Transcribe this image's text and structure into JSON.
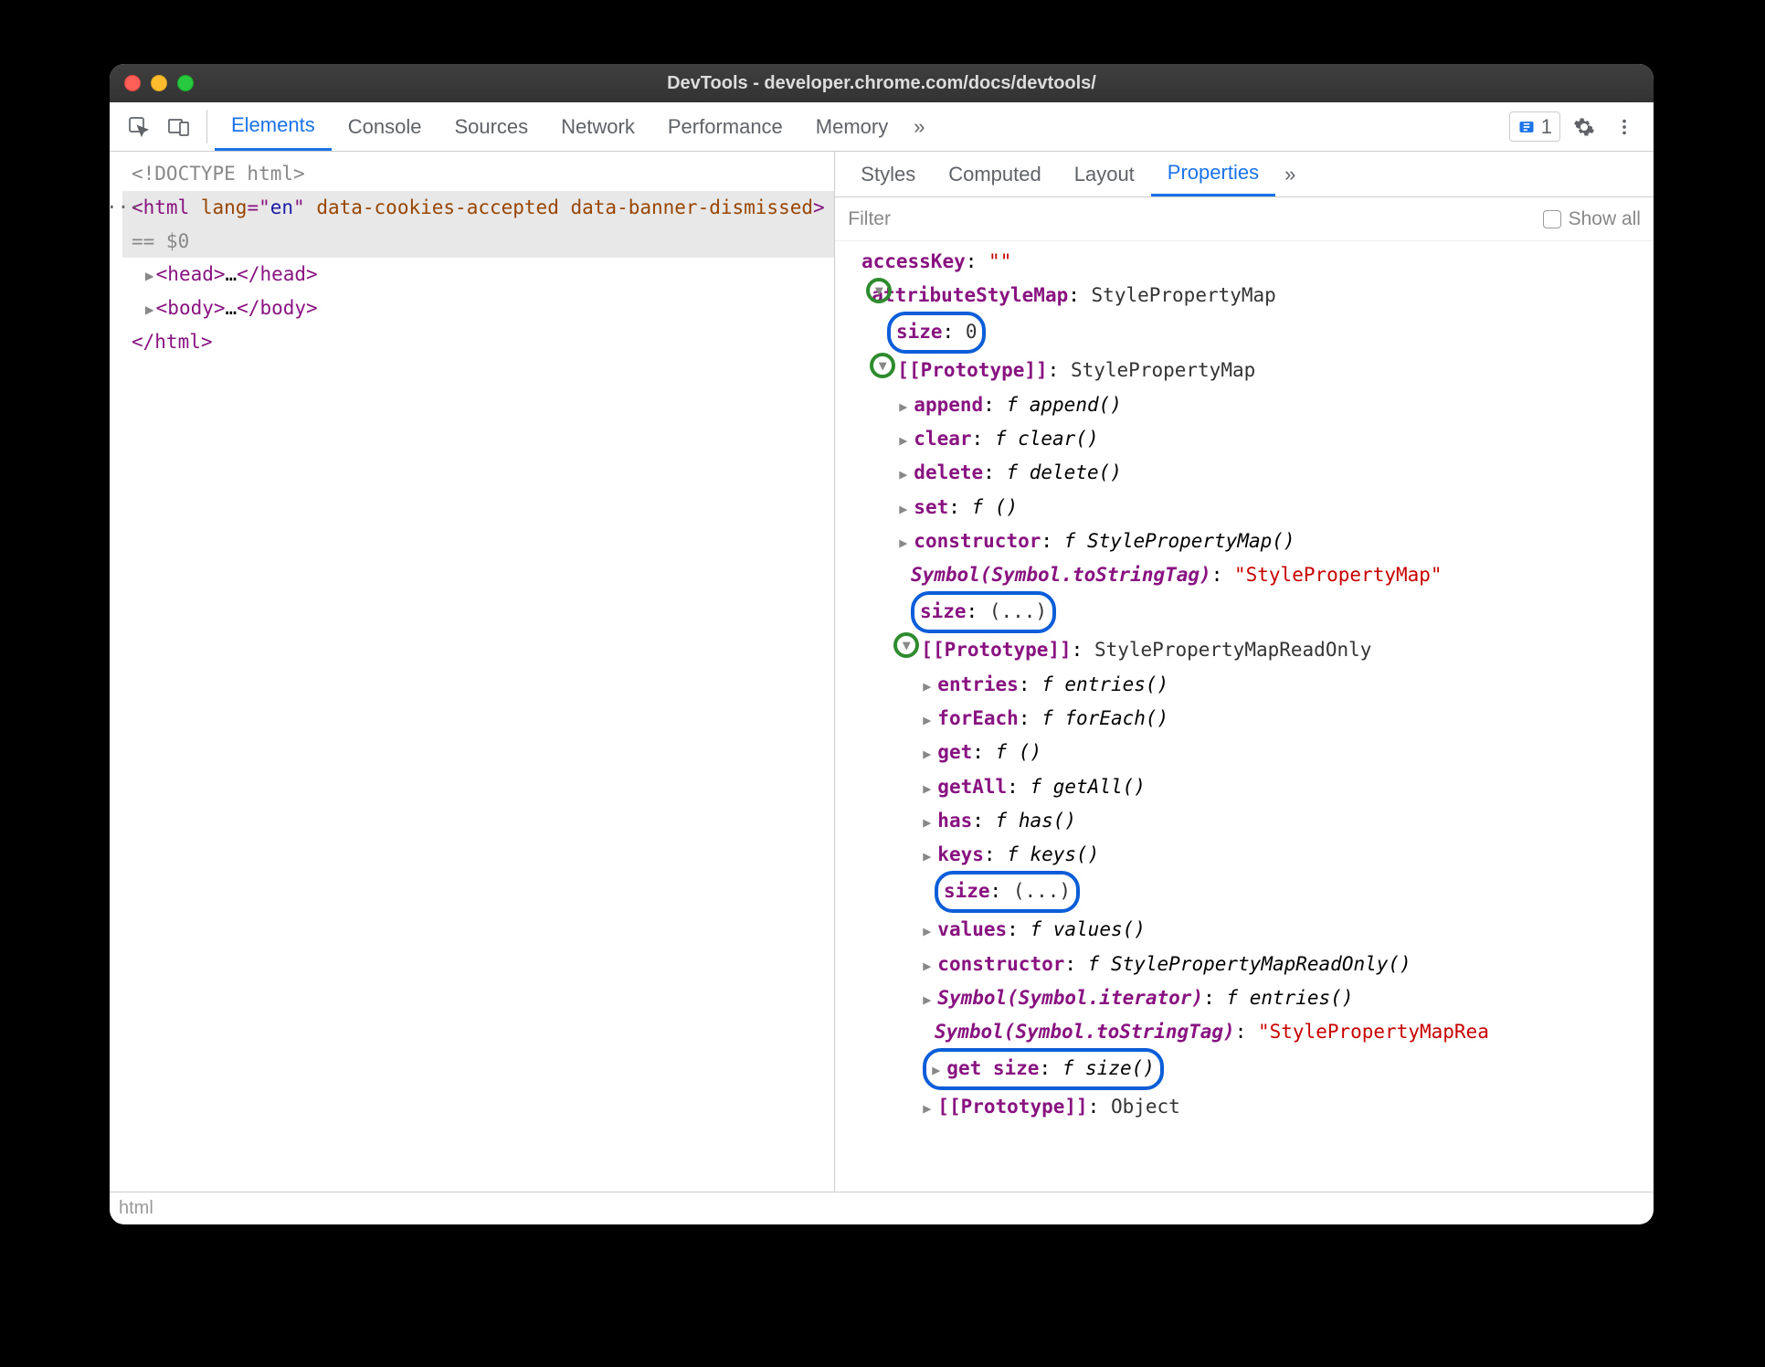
{
  "titlebar": {
    "title": "DevTools - developer.chrome.com/docs/devtools/"
  },
  "toolbar": {
    "tabs": [
      "Elements",
      "Console",
      "Sources",
      "Network",
      "Performance",
      "Memory"
    ],
    "active": "Elements",
    "moreGlyph": "»",
    "issuesCount": "1"
  },
  "dom": {
    "doctype": "<!DOCTYPE html>",
    "htmlOpen": {
      "tag": "html",
      "attrs": [
        {
          "name": "lang",
          "value": "en"
        },
        {
          "name": "data-cookies-accepted",
          "value": null
        },
        {
          "name": "data-banner-dismissed",
          "value": null
        }
      ],
      "selRef": "== $0"
    },
    "headLine": "<head>…</head>",
    "bodyLine": "<body>…</body>",
    "htmlClose": "</html>"
  },
  "crumb": "html",
  "sidebar": {
    "tabs": [
      "Styles",
      "Computed",
      "Layout",
      "Properties"
    ],
    "active": "Properties",
    "moreGlyph": "»",
    "filterLabel": "Filter",
    "showAll": "Show all"
  },
  "props": {
    "accessKey": {
      "name": "accessKey",
      "value": "\"\""
    },
    "attributeStyleMap": {
      "name": "attributeStyleMap",
      "value": "StylePropertyMap",
      "size": {
        "name": "size",
        "value": "0"
      },
      "proto": {
        "name": "[[Prototype]]",
        "value": "StylePropertyMap",
        "members": [
          {
            "name": "append",
            "fn": "append()"
          },
          {
            "name": "clear",
            "fn": "clear()"
          },
          {
            "name": "delete",
            "fn": "delete()"
          },
          {
            "name": "set",
            "fn": "()"
          },
          {
            "name": "constructor",
            "fn": "StylePropertyMap()"
          }
        ],
        "symbolTag": {
          "name": "Symbol(Symbol.toStringTag)",
          "value": "\"StylePropertyMap\""
        },
        "sizeEllipsis": {
          "name": "size",
          "value": "(...)"
        },
        "proto2": {
          "name": "[[Prototype]]",
          "value": "StylePropertyMapReadOnly",
          "members": [
            {
              "name": "entries",
              "fn": "entries()"
            },
            {
              "name": "forEach",
              "fn": "forEach()"
            },
            {
              "name": "get",
              "fn": "()"
            },
            {
              "name": "getAll",
              "fn": "getAll()"
            },
            {
              "name": "has",
              "fn": "has()"
            },
            {
              "name": "keys",
              "fn": "keys()"
            }
          ],
          "sizeEllipsis": {
            "name": "size",
            "value": "(...)"
          },
          "members2": [
            {
              "name": "values",
              "fn": "values()"
            },
            {
              "name": "constructor",
              "fn": "StylePropertyMapReadOnly()"
            },
            {
              "name": "Symbol(Symbol.iterator)",
              "fn": "entries()",
              "symbol": true
            }
          ],
          "symbolTag": {
            "name": "Symbol(Symbol.toStringTag)",
            "value": "\"StylePropertyMapRea"
          },
          "getSize": {
            "name": "get size",
            "fn": "size()"
          },
          "proto3": {
            "name": "[[Prototype]]",
            "value": "Object"
          }
        }
      }
    }
  }
}
